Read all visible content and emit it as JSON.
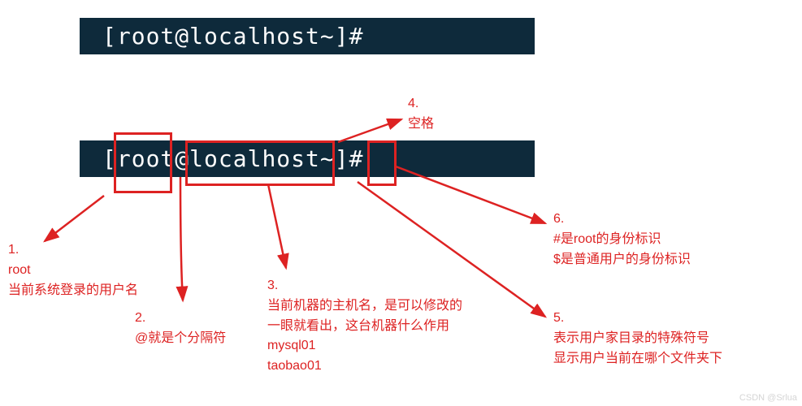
{
  "terminal": {
    "bracket_open": "[",
    "user": "root",
    "at": "@",
    "host": "localhost",
    "space": " ",
    "dir": "~",
    "bracket_close": "]",
    "prompt": "#"
  },
  "annotations": {
    "n1": "1.\nroot\n当前系统登录的用户名",
    "n2": "2.\n@就是个分隔符",
    "n3": "3.\n当前机器的主机名，是可以修改的\n一眼就看出，这台机器什么作用\nmysql01\ntaobao01",
    "n4": "4.\n空格",
    "n5": "5.\n表示用户家目录的特殊符号\n显示用户当前在哪个文件夹下",
    "n6": "6.\n#是root的身份标识\n$是普通用户的身份标识"
  },
  "watermark": "CSDN @Srlua"
}
